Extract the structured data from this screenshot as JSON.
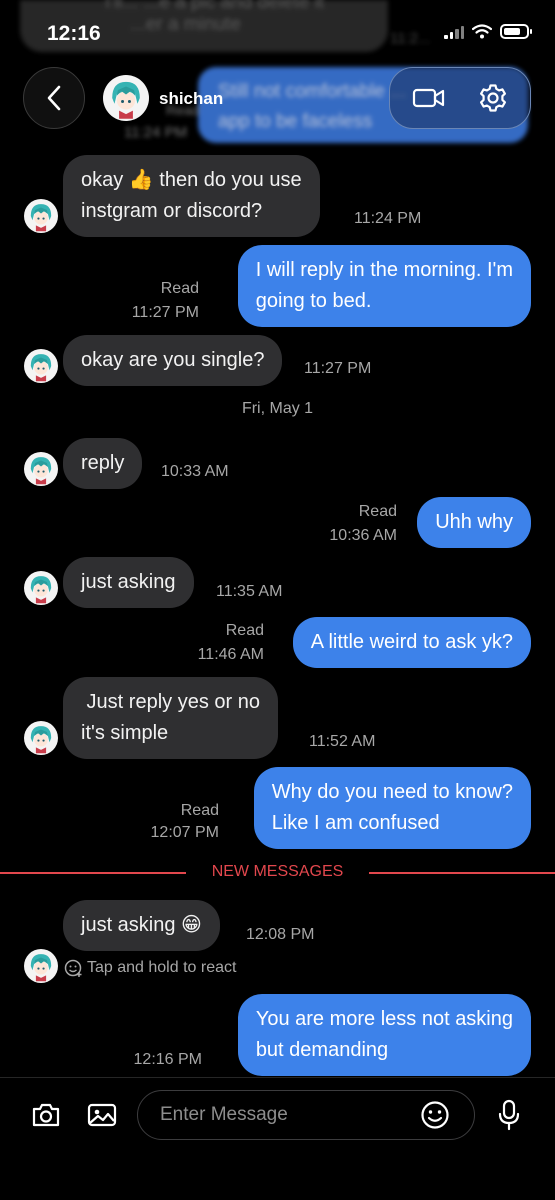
{
  "status_bar": {
    "time": "12:16"
  },
  "background_preview": {
    "incoming_line1": "I'll... ...e a pic and delete it",
    "incoming_line2": "...er a minute",
    "ghost_time": "11:2...",
    "outgoing_line1": "Still not comfortable ...",
    "outgoing_line2": "app to be faceless",
    "read_label": "Read",
    "time": "11:24 PM"
  },
  "header": {
    "contact_name": "shichan",
    "back_icon": "chevron-left-icon",
    "video_icon": "video-camera-icon",
    "settings_icon": "gear-icon"
  },
  "messages": [
    {
      "dir": "in",
      "lines": [
        "okay 👍 then do you use",
        "instgram or discord?"
      ],
      "time": "11:24 PM"
    },
    {
      "dir": "out",
      "lines": [
        "I will reply in the morning. I'm",
        "going to bed."
      ],
      "read": "Read",
      "time": "11:27 PM"
    },
    {
      "dir": "in",
      "lines": [
        "okay are you single?"
      ],
      "time": "11:27 PM"
    },
    {
      "dir": "in",
      "lines": [
        "reply"
      ],
      "time": "10:33 AM"
    },
    {
      "dir": "out",
      "lines": [
        "Uhh  why"
      ],
      "read": "Read",
      "time": "10:36 AM"
    },
    {
      "dir": "in",
      "lines": [
        "just asking"
      ],
      "time": "11:35 AM"
    },
    {
      "dir": "out",
      "lines": [
        "A little weird to ask yk?"
      ],
      "read": "Read",
      "time": "11:46 AM"
    },
    {
      "dir": "in",
      "lines": [
        " Just reply yes or no",
        "it's simple"
      ],
      "time": "11:52 AM"
    },
    {
      "dir": "out",
      "lines": [
        "Why do you need to know?",
        "Like I am confused"
      ],
      "read": "Read",
      "time": "12:07 PM"
    },
    {
      "dir": "in",
      "lines": [
        "just asking 😁"
      ],
      "time": "12:08 PM"
    },
    {
      "dir": "out",
      "lines": [
        "You are more less not asking",
        "but demanding"
      ],
      "time": "12:16 PM"
    }
  ],
  "date_separator": "Fri, May 1",
  "new_messages_label": "NEW MESSAGES",
  "react_hint": "Tap and hold to react",
  "composer": {
    "placeholder": "Enter Message",
    "camera_icon": "camera-icon",
    "gallery_icon": "image-icon",
    "emoji_icon": "smiley-icon",
    "mic_icon": "microphone-icon"
  },
  "colors": {
    "outgoing_bubble": "#3d82ea",
    "incoming_bubble": "#2f2f31",
    "new_messages_accent": "#e2474d",
    "background": "#000000"
  }
}
